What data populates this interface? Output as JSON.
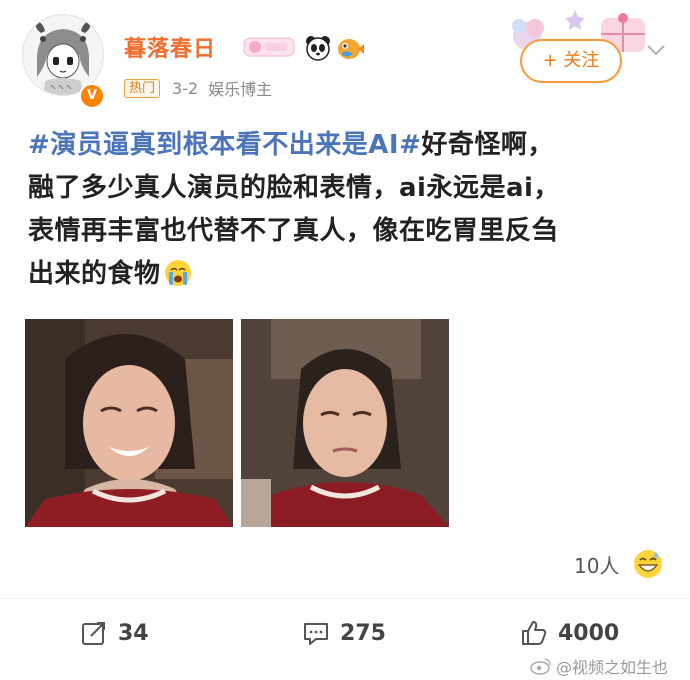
{
  "post": {
    "username": "暮落春日",
    "hot_tag": "热门",
    "date": "3-2",
    "role": "娱乐博主",
    "follow_label": "+ 关注",
    "verified_badge": "V",
    "topic": "#演员逼真到根本看不出来是AI#",
    "line1_rest": "好奇怪啊，",
    "line2": "融了多少真人演员的脸和表情，ai永远是ai，",
    "line3": "表情再丰富也代替不了真人，像在吃胃里反刍",
    "line4": "出来的食物",
    "likes_people": "10人",
    "repost_count": "34",
    "comment_count": "275",
    "like_count": "4000",
    "watermark": "@视频之如生也"
  },
  "icons": {
    "avatar": "anime-girl-avatar",
    "emoji_after_text": "crying-face-emoji",
    "emoji_likes": "grinning-sweat-emoji",
    "header_emojis": [
      "panda-icon",
      "pufferfish-icon"
    ],
    "repost": "repost-icon",
    "comment": "comment-icon",
    "like": "thumbs-up-icon",
    "more": "chevron-down-icon"
  },
  "colors": {
    "username": "#f26c2b",
    "topic": "#4c74b8",
    "follow_border": "#f79b3a",
    "hot_tag": "#e07d12"
  }
}
